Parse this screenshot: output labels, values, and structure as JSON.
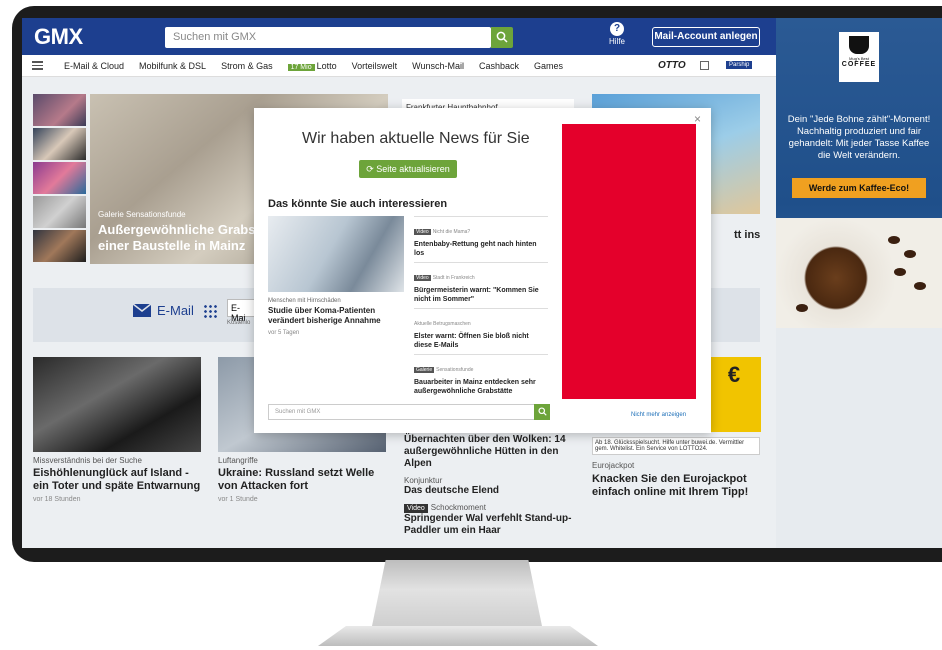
{
  "header": {
    "logo": "GMX",
    "search_placeholder": "Suchen mit GMX",
    "help_label": "Hilfe",
    "account_button": "Mail-Account anlegen"
  },
  "nav": {
    "items": [
      "E-Mail & Cloud",
      "Mobilfunk & DSL",
      "Strom & Gas",
      "Lotto",
      "Vorteilswelt",
      "Wunsch-Mail",
      "Cashback",
      "Games"
    ],
    "lotto_badge": "17 Mio",
    "otto": "OTTO",
    "parship": "Parship"
  },
  "hero": {
    "meta": "Galerie  Sensationsfunde",
    "title": "Außergewöhnliche Grabst einer Baustelle in Mainz"
  },
  "right_col_label": "Frankfurter Hauptbahnhof",
  "sea_title": "tt ins",
  "mailbar": {
    "label": "E-Mail",
    "input_value": "E-Mai",
    "sub": "Kostenlo"
  },
  "cards": [
    {
      "meta": "Missverständnis bei der Suche",
      "title": "Eishöhlenunglück auf Island - ein Toter und späte Entwarnung",
      "time": "vor 18 Stunden"
    },
    {
      "meta": "Luftangriffe",
      "title": "Ukraine: Russland setzt Welle von Attacken fort",
      "time": "vor 1 Stunde"
    }
  ],
  "mid_list": {
    "t1": "Übernachten über den Wolken: 14 außergewöhnliche Hütten in den Alpen",
    "m1": "Konjunktur",
    "t2": "Das deutsche Elend",
    "tag": "Video",
    "m3": "Schockmoment",
    "t3": "Springender Wal verfehlt Stand-up-Paddler um ein Haar"
  },
  "euro_ad": "€",
  "lotto_note": "Ab 18. Glücksspielsucht. Hilfe unter buwei.de. Vermittler gem. Whitelist. Ein Service von LOTTO24.",
  "card3": {
    "meta": "Eurojackpot",
    "title": "Knacken Sie den Eurojackpot einfach online mit Ihrem Tipp!"
  },
  "modal": {
    "close": "×",
    "title": "Wir haben aktuelle News für Sie",
    "refresh": "Seite aktualisieren",
    "interest": "Das könnte Sie auch interessieren",
    "main_meta": "Menschen mit Hirnschäden",
    "main_title": "Studie über Koma-Patienten verändert bisherige Annahme",
    "main_time": "vor 5 Tagen",
    "items": [
      {
        "tag": "Video",
        "sub": "Nicht die Mama?",
        "title": "Entenbaby-Rettung geht nach hinten los"
      },
      {
        "tag": "Video",
        "sub": "Stadt in Frankreich",
        "title": "Bürgermeisterin warnt: \"Kommen Sie nicht im Sommer\""
      },
      {
        "tag": "",
        "sub": "Aktuelle Betrugsmaschen",
        "title": "Elster warnt: Öffnen Sie bloß nicht diese E-Mails"
      },
      {
        "tag": "Galerie",
        "sub": "Sensationsfunde",
        "title": "Bauarbeiter in Mainz entdecken sehr außergewöhnliche Grabstätte"
      }
    ],
    "search_placeholder": "Suchen mit GMX",
    "no_more": "Nicht mehr anzeigen"
  },
  "side_ad": {
    "brand_top": "Mug's Best",
    "brand": "COFFEE",
    "text": "Dein \"Jede Bohne zählt\"-Moment! Nachhaltig produziert und fair gehandelt: Mit jeder Tasse Kaffee die Welt verändern.",
    "button": "Werde zum Kaffee-Eco!"
  }
}
